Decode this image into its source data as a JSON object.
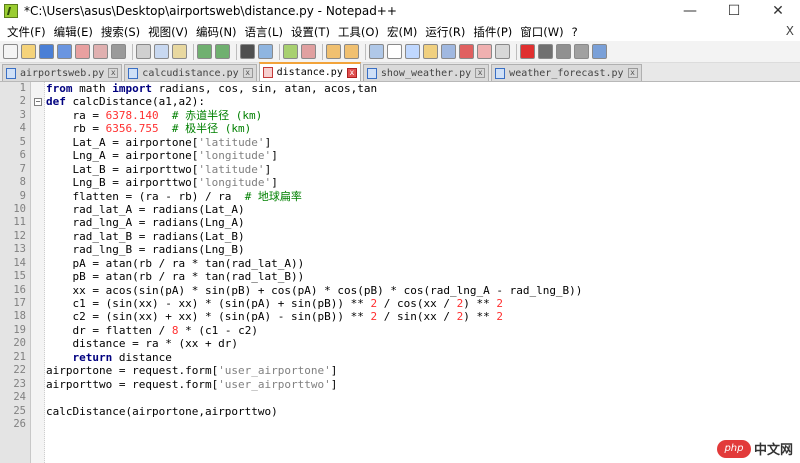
{
  "window": {
    "title": "*C:\\Users\\asus\\Desktop\\airportsweb\\distance.py - Notepad++",
    "minimize": "—",
    "maximize": "☐",
    "close": "✕"
  },
  "menu": [
    "文件(F)",
    "编辑(E)",
    "搜索(S)",
    "视图(V)",
    "编码(N)",
    "语言(L)",
    "设置(T)",
    "工具(O)",
    "宏(M)",
    "运行(R)",
    "插件(P)",
    "窗口(W)",
    "?"
  ],
  "menu_close": "X",
  "tabs": [
    {
      "label": "airportsweb.py",
      "active": false
    },
    {
      "label": "calcudistance.py",
      "active": false
    },
    {
      "label": "distance.py",
      "active": true
    },
    {
      "label": "show_weather.py",
      "active": false
    },
    {
      "label": "weather_forecast.py",
      "active": false
    }
  ],
  "tab_close": "x",
  "fold_collapse": "−",
  "code_lines": [
    [
      [
        "kw",
        "from"
      ],
      [
        "p",
        " math "
      ],
      [
        "kw",
        "import"
      ],
      [
        "p",
        " radians, cos, sin, atan, acos,tan"
      ]
    ],
    [
      [
        "kw",
        "def"
      ],
      [
        "p",
        " calcDistance(a1,a2):"
      ]
    ],
    [
      [
        "p",
        "    ra = "
      ],
      [
        "num",
        "6378.140"
      ],
      [
        "p",
        "  "
      ],
      [
        "cm",
        "# 赤道半径 (km)"
      ]
    ],
    [
      [
        "p",
        "    rb = "
      ],
      [
        "num",
        "6356.755"
      ],
      [
        "p",
        "  "
      ],
      [
        "cm",
        "# 极半径 (km)"
      ]
    ],
    [
      [
        "p",
        "    Lat_A = airportone["
      ],
      [
        "str",
        "'latitude'"
      ],
      [
        "p",
        "]"
      ]
    ],
    [
      [
        "p",
        "    Lng_A = airportone["
      ],
      [
        "str",
        "'longitude'"
      ],
      [
        "p",
        "]"
      ]
    ],
    [
      [
        "p",
        "    Lat_B = airporttwo["
      ],
      [
        "str",
        "'latitude'"
      ],
      [
        "p",
        "]"
      ]
    ],
    [
      [
        "p",
        "    Lng_B = airporttwo["
      ],
      [
        "str",
        "'longitude'"
      ],
      [
        "p",
        "]"
      ]
    ],
    [
      [
        "p",
        "    flatten = (ra - rb) / ra  "
      ],
      [
        "cm",
        "# 地球扁率"
      ]
    ],
    [
      [
        "p",
        "    rad_lat_A = radians(Lat_A)"
      ]
    ],
    [
      [
        "p",
        "    rad_lng_A = radians(Lng_A)"
      ]
    ],
    [
      [
        "p",
        "    rad_lat_B = radians(Lat_B)"
      ]
    ],
    [
      [
        "p",
        "    rad_lng_B = radians(Lng_B)"
      ]
    ],
    [
      [
        "p",
        "    pA = atan(rb / ra * tan(rad_lat_A))"
      ]
    ],
    [
      [
        "p",
        "    pB = atan(rb / ra * tan(rad_lat_B))"
      ]
    ],
    [
      [
        "p",
        "    xx = acos(sin(pA) * sin(pB) + cos(pA) * cos(pB) * cos(rad_lng_A - rad_lng_B))"
      ]
    ],
    [
      [
        "p",
        "    c1 = (sin(xx) - xx) * (sin(pA) + sin(pB)) ** "
      ],
      [
        "num",
        "2"
      ],
      [
        "p",
        " / cos(xx / "
      ],
      [
        "num",
        "2"
      ],
      [
        "p",
        ") ** "
      ],
      [
        "num",
        "2"
      ]
    ],
    [
      [
        "p",
        "    c2 = (sin(xx) + xx) * (sin(pA) - sin(pB)) ** "
      ],
      [
        "num",
        "2"
      ],
      [
        "p",
        " / sin(xx / "
      ],
      [
        "num",
        "2"
      ],
      [
        "p",
        ") ** "
      ],
      [
        "num",
        "2"
      ]
    ],
    [
      [
        "p",
        "    dr = flatten / "
      ],
      [
        "num",
        "8"
      ],
      [
        "p",
        " * (c1 - c2)"
      ]
    ],
    [
      [
        "p",
        "    distance = ra * (xx + dr)"
      ]
    ],
    [
      [
        "p",
        "    "
      ],
      [
        "kw",
        "return"
      ],
      [
        "p",
        " distance"
      ]
    ],
    [
      [
        "p",
        "airportone = request.form["
      ],
      [
        "str",
        "'user_airportone'"
      ],
      [
        "p",
        "]"
      ]
    ],
    [
      [
        "p",
        "airporttwo = request.form["
      ],
      [
        "str",
        "'user_airporttwo'"
      ],
      [
        "p",
        "]"
      ]
    ],
    [
      [
        "p",
        ""
      ]
    ],
    [
      [
        "p",
        "calcDistance(airportone,airporttwo)"
      ]
    ],
    [
      [
        "p",
        ""
      ]
    ]
  ],
  "watermark": {
    "logo": "php",
    "text": "中文网"
  }
}
